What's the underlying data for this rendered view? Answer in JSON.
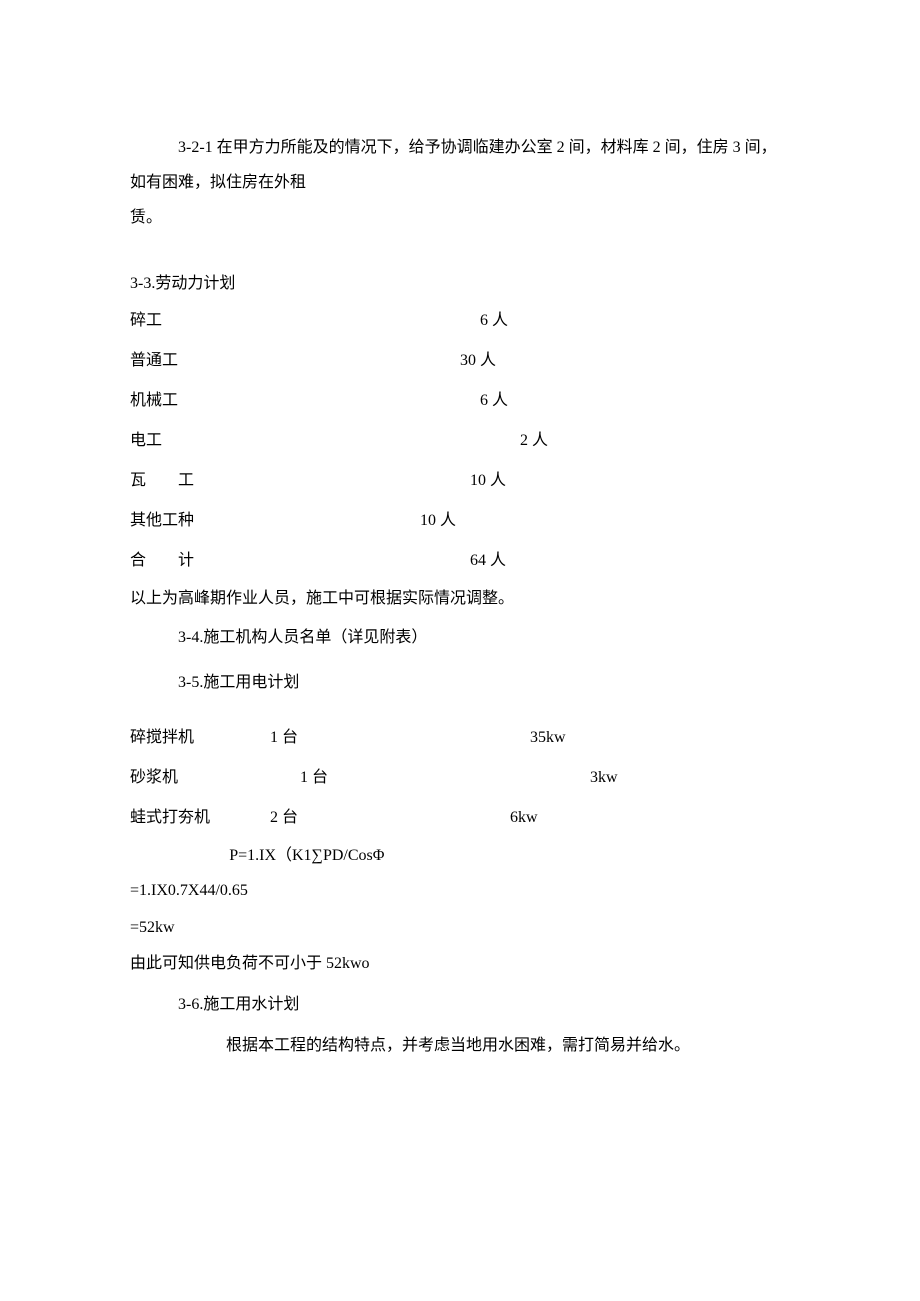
{
  "para_321": "3-2-1 在甲方力所能及的情况下，给予协调临建办公室 2 间，材料库 2 间，住房 3 间，如有困难，拟住房在外租",
  "para_321_cont": "赁。",
  "section_33": "3-3.劳动力计划",
  "labor": [
    {
      "label": "碎工",
      "value": "6 人",
      "spaced": false,
      "value_pad": 20
    },
    {
      "label": "普通工",
      "value": "30 人",
      "spaced": false,
      "value_pad": 0
    },
    {
      "label": "机械工",
      "value": "6 人",
      "spaced": false,
      "value_pad": 20
    },
    {
      "label": "电工",
      "value": "2 人",
      "spaced": false,
      "value_pad": 60
    },
    {
      "label": "瓦　　工",
      "value": "10 人",
      "spaced": false,
      "value_pad": 10
    },
    {
      "label": "其他工种",
      "value": "10 人",
      "spaced": false,
      "value_pad": -40,
      "label_wide": true
    },
    {
      "label": "合　　计",
      "value": "64 人",
      "spaced": false,
      "value_pad": 10
    }
  ],
  "labor_note": "以上为高峰期作业人员，施工中可根据实际情况调整。",
  "section_34": "3-4.施工机构人员名单（详见附表）",
  "section_35": "3-5.施工用电计划",
  "equipment": [
    {
      "name": "碎搅拌机",
      "qty": "1 台",
      "power": "35kw",
      "qty_pad": 0,
      "power_pad": 40
    },
    {
      "name": "砂浆机",
      "qty": "1 台",
      "power": "3kw",
      "qty_pad": 30,
      "power_pad": 100
    },
    {
      "name": "蛙式打夯机",
      "qty": "2 台",
      "power": "6kw",
      "qty_pad": -20,
      "power_pad": 20
    }
  ],
  "formula1": "P=1.IX（K1∑PD/CosΦ",
  "formula2": "=1.IX0.7X44/0.65",
  "formula3": "=52kw",
  "load_note": "由此可知供电负荷不可小于 52kwo",
  "section_36": "3-6.施工用水计划",
  "water_note": "根据本工程的结构特点，并考虑当地用水困难，需打简易并给水。"
}
